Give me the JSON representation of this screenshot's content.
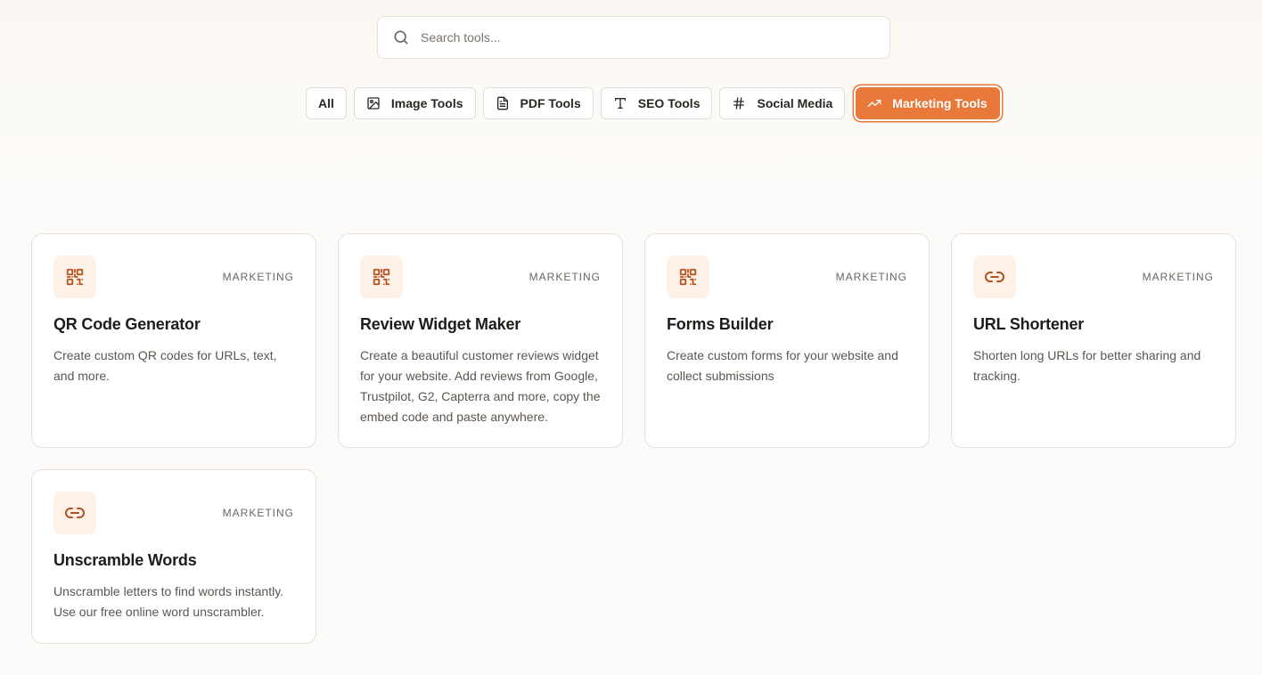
{
  "search": {
    "placeholder": "Search tools...",
    "value": ""
  },
  "filters": [
    {
      "label": "All",
      "icon": "none",
      "active": false
    },
    {
      "label": "Image Tools",
      "icon": "image-icon",
      "active": false
    },
    {
      "label": "PDF Tools",
      "icon": "file-text-icon",
      "active": false
    },
    {
      "label": "SEO Tools",
      "icon": "type-icon",
      "active": false
    },
    {
      "label": "Social Media",
      "icon": "hash-icon",
      "active": false
    },
    {
      "label": "Marketing Tools",
      "icon": "trending-up-icon",
      "active": true
    }
  ],
  "tools": [
    {
      "title": "QR Code Generator",
      "category": "MARKETING",
      "icon": "qr-code-icon",
      "description": "Create custom QR codes for URLs, text, and more."
    },
    {
      "title": "Review Widget Maker",
      "category": "MARKETING",
      "icon": "qr-code-icon",
      "description": "Create a beautiful customer reviews widget for your website. Add reviews from Google, Trustpilot, G2, Capterra and more, copy the embed code and paste anywhere."
    },
    {
      "title": "Forms Builder",
      "category": "MARKETING",
      "icon": "qr-code-icon",
      "description": "Create custom forms for your website and collect submissions"
    },
    {
      "title": "URL Shortener",
      "category": "MARKETING",
      "icon": "link-icon",
      "description": "Shorten long URLs for better sharing and tracking."
    },
    {
      "title": "Unscramble Words",
      "category": "MARKETING",
      "icon": "link-icon",
      "description": "Unscramble letters to find words instantly. Use our free online word unscrambler."
    }
  ],
  "colors": {
    "accent": "#e8793a",
    "icon_tint": "#b4511d",
    "icon_bg": "#fdf1e8"
  }
}
